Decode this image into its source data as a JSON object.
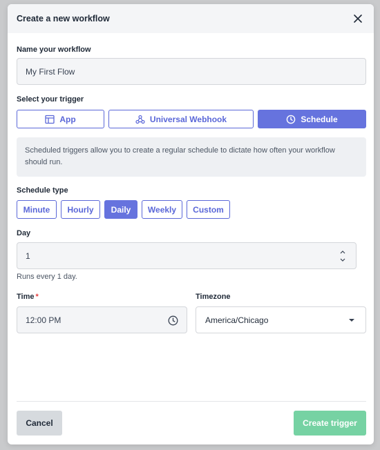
{
  "modal": {
    "title": "Create a new workflow"
  },
  "workflow_name": {
    "label": "Name your workflow",
    "value": "My First Flow"
  },
  "trigger": {
    "label": "Select your trigger",
    "options": [
      {
        "label": "App",
        "icon": "layout-icon",
        "active": false
      },
      {
        "label": "Universal Webhook",
        "icon": "webhook-icon",
        "active": false
      },
      {
        "label": "Schedule",
        "icon": "clock-icon",
        "active": true
      }
    ],
    "info": "Scheduled triggers allow you to create a regular schedule to dictate how often your workflow should run."
  },
  "schedule_type": {
    "label": "Schedule type",
    "options": [
      "Minute",
      "Hourly",
      "Daily",
      "Weekly",
      "Custom"
    ],
    "selected": "Daily"
  },
  "day": {
    "label": "Day",
    "value": "1",
    "hint": "Runs every 1 day."
  },
  "time": {
    "label": "Time",
    "required_mark": "*",
    "value": "12:00 PM"
  },
  "timezone": {
    "label": "Timezone",
    "value": "America/Chicago"
  },
  "footer": {
    "cancel_label": "Cancel",
    "create_label": "Create trigger"
  },
  "colors": {
    "accent": "#6673de",
    "create_button": "#76d2a3",
    "required": "#e53e3e"
  }
}
